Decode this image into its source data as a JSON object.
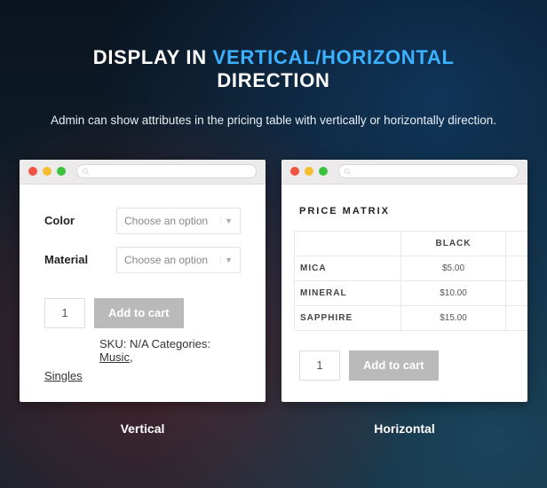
{
  "header": {
    "title_pre": "DISPLAY IN ",
    "title_accent": "VERTICAL/HORIZONTAL",
    "title_post": " DIRECTION",
    "subtitle": "Admin can show attributes in the pricing table with vertically or horizontally direction."
  },
  "vertical": {
    "caption": "Vertical",
    "attributes": [
      {
        "label": "Color",
        "placeholder": "Choose an option"
      },
      {
        "label": "Material",
        "placeholder": "Choose an option"
      }
    ],
    "qty": "1",
    "add_to_cart": "Add to cart",
    "meta_sku_prefix": "SKU: N/A Categories: ",
    "meta_cat1": "Music",
    "meta_comma": ",",
    "meta_cat2": "Singles"
  },
  "horizontal": {
    "caption": "Horizontal",
    "matrix_title": "PRICE MATRIX",
    "header_cell": "BLACK",
    "rows": [
      {
        "name": "MICA",
        "price": "$5.00"
      },
      {
        "name": "MINERAL",
        "price": "$10.00"
      },
      {
        "name": "SAPPHIRE",
        "price": "$15.00"
      }
    ],
    "qty": "1",
    "add_to_cart": "Add to cart"
  }
}
